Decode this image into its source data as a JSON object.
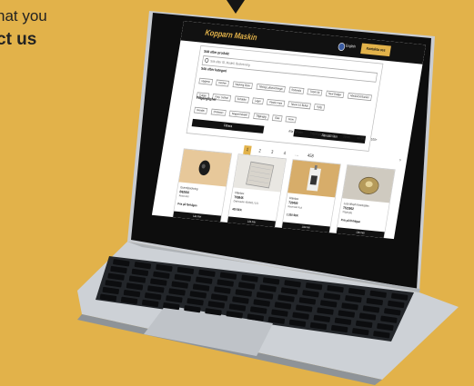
{
  "background": {
    "line1": "hat you",
    "line2": "ct us",
    "bg_color": "#e2b24a",
    "accent": "#e2b24a"
  },
  "site": {
    "brand": "Kopparn Maskin",
    "language": "English",
    "cta": "Kontakta oss"
  },
  "search_panel": {
    "title": "Sök efter produkt",
    "placeholder": "Sök efter ID, Modell, Beskrivning",
    "categories_title": "Sök efter kategori",
    "categories": [
      "Hygiene",
      "Kitchen",
      "Washing Dryer",
      "Tiltning Lyftanordningar",
      "Rationale",
      "TASKI 84",
      "Neat Dodger",
      "Allmän/Ort/Sanitet",
      "Tvättar",
      "Förp. Suthan",
      "Schabbe",
      "Lager",
      "Plastic trops",
      "Teknik 3.0 Bulldz",
      "Kylig"
    ],
    "tags_title": "Tillgänglighet",
    "tags": [
      "Wonder",
      "Chateaux",
      "Magnet Modell",
      "Tillgänglig",
      "Glas",
      "Ferm"
    ],
    "filter_button": "Filtrera",
    "clear_button": "Återställ filter"
  },
  "tabs": [
    "Alla nyheter",
    "Tillgänglig",
    "Spare",
    "20-50",
    "50-99",
    "100+"
  ],
  "pagination": {
    "pages": [
      "1",
      "2",
      "3",
      "4",
      "…",
      "458"
    ],
    "next": "›"
  },
  "cards": [
    {
      "name": "Gummipackning",
      "id": "B62910",
      "sub": "Reservdel",
      "price": "Pris på förfrågan",
      "button": "Läs mer"
    },
    {
      "name": "Filterbox",
      "id": "T00845",
      "sub": "Diskmaskin 400/600 | 101",
      "price": "400 SEK",
      "button": "Läs mer"
    },
    {
      "name": "Filterbox",
      "id": "T20400",
      "sub": "Reservdel Kok",
      "price": "1 200 SEK",
      "button": "Läs mer"
    },
    {
      "name": "Lock tillverk Kosmoplex",
      "id": "T523902",
      "sub": "Tillgänglig",
      "price": "Pris på förfrågan",
      "button": "Läs mer"
    }
  ]
}
